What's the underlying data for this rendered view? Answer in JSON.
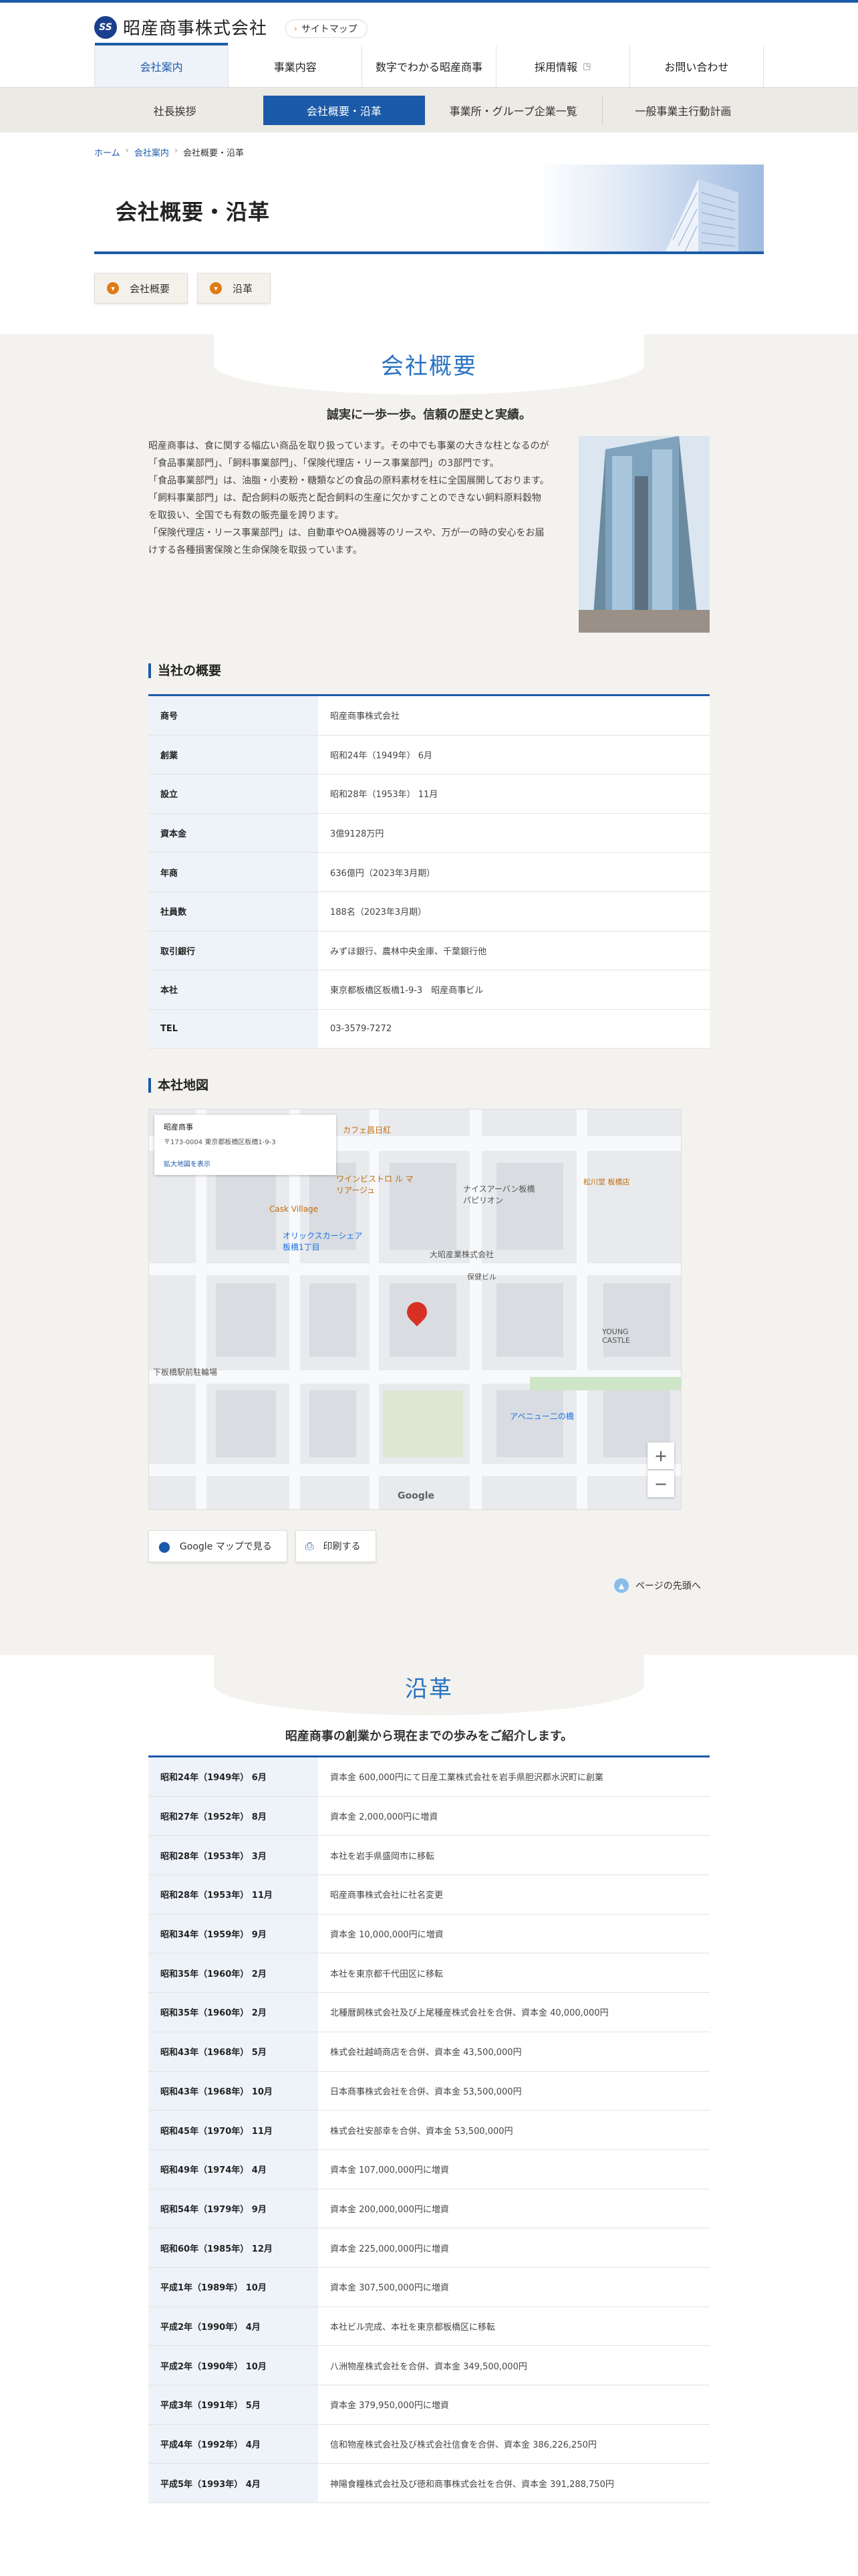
{
  "header": {
    "logo_mark": "SS",
    "company_name": "昭産商事株式会社",
    "sitemap_label": "サイトマップ"
  },
  "global_nav": [
    {
      "label": "会社案内",
      "active": true
    },
    {
      "label": "事業内容",
      "active": false
    },
    {
      "label": "数字でわかる昭産商事",
      "active": false
    },
    {
      "label": "採用情報",
      "active": false
    },
    {
      "label": "お問い合わせ",
      "active": false
    }
  ],
  "sub_nav": [
    {
      "label": "社長挨拶",
      "active": false
    },
    {
      "label": "会社概要・沿革",
      "active": true
    },
    {
      "label": "事業所・グループ企業一覧",
      "active": false
    },
    {
      "label": "一般事業主行動計画",
      "active": false
    }
  ],
  "breadcrumb": {
    "home": "ホーム",
    "parent": "会社案内",
    "current": "会社概要・沿革"
  },
  "page_title": "会社概要・沿革",
  "anchors": [
    {
      "label": "会社概要"
    },
    {
      "label": "沿革"
    }
  ],
  "overview": {
    "title": "会社概要",
    "lead": "誠実に一歩一歩。信頼の歴史と実績。",
    "intro": [
      "昭産商事は、食に関する幅広い商品を取り扱っています。その中でも事業の大きな柱となるのが「食品事業部門」、「飼料事業部門」、「保険代理店・リース事業部門」の3部門です。",
      "「食品事業部門」は、油脂・小麦粉・糖類などの食品の原料素材を柱に全国展開しております。",
      "「飼料事業部門」は、配合飼料の販売と配合飼料の生産に欠かすことのできない飼料原料穀物を取扱い、全国でも有数の販売量を誇ります。",
      "「保険代理店・リース事業部門」は、自動車やOA機器等のリースや、万が一の時の安心をお届けする各種損害保険と生命保険を取扱っています。"
    ],
    "outline_heading": "当社の概要",
    "outline": [
      {
        "th": "商号",
        "td": "昭産商事株式会社"
      },
      {
        "th": "創業",
        "td": "昭和24年（1949年） 6月"
      },
      {
        "th": "設立",
        "td": "昭和28年（1953年） 11月"
      },
      {
        "th": "資本金",
        "td": "3億9128万円"
      },
      {
        "th": "年商",
        "td": "636億円（2023年3月期）"
      },
      {
        "th": "社員数",
        "td": "188名（2023年3月期）"
      },
      {
        "th": "取引銀行",
        "td": "みずほ銀行、農林中央金庫、千葉銀行他"
      },
      {
        "th": "本社",
        "td": "東京都板橋区板橋1-9-3　昭産商事ビル"
      },
      {
        "th": "TEL",
        "td": "03-3579-7272"
      }
    ],
    "map_heading": "本社地図",
    "map_info": {
      "name": "昭産商事",
      "addr": "〒173-0004 東京都板橋区板橋1-9-3",
      "link": "拡大地図を表示"
    },
    "map_labels": [
      "カフェ昌日紅",
      "ワインビストロ ル マリアージュ",
      "Cask Village",
      "オリックスカーシェア 板橋1丁目",
      "ナイスアーバン板橋 パピリオン",
      "松川堂 板橋店",
      "大昭産業株式会社",
      "保健ビル",
      "YOUNG CASTLE",
      "アベニュー二の橋",
      "下板橋駅前駐輪場",
      "Google"
    ],
    "map_button": "Google マップで見る",
    "print_button": "印刷する",
    "page_top": "ページの先頭へ"
  },
  "history": {
    "title": "沿革",
    "lead": "昭産商事の創業から現在までの歩みをご紹介します。",
    "rows": [
      {
        "th": "昭和24年（1949年） 6月",
        "td": "資本金 600,000円にて日産工業株式会社を岩手県胆沢郡水沢町に創業"
      },
      {
        "th": "昭和27年（1952年） 8月",
        "td": "資本金 2,000,000円に増資"
      },
      {
        "th": "昭和28年（1953年） 3月",
        "td": "本社を岩手県盛岡市に移転"
      },
      {
        "th": "昭和28年（1953年） 11月",
        "td": "昭産商事株式会社に社名変更"
      },
      {
        "th": "昭和34年（1959年） 9月",
        "td": "資本金 10,000,000円に増資"
      },
      {
        "th": "昭和35年（1960年） 2月",
        "td": "本社を東京都千代田区に移転"
      },
      {
        "th": "昭和35年（1960年） 2月",
        "td": "北種暦飼株式会社及び上尾種産株式会社を合併、資本金 40,000,000円"
      },
      {
        "th": "昭和43年（1968年） 5月",
        "td": "株式会社越崎商店を合併、資本金 43,500,000円"
      },
      {
        "th": "昭和43年（1968年） 10月",
        "td": "日本商事株式会社を合併、資本金 53,500,000円"
      },
      {
        "th": "昭和45年（1970年） 11月",
        "td": "株式会社安部幸を合併、資本金 53,500,000円"
      },
      {
        "th": "昭和49年（1974年） 4月",
        "td": "資本金 107,000,000円に増資"
      },
      {
        "th": "昭和54年（1979年） 9月",
        "td": "資本金 200,000,000円に増資"
      },
      {
        "th": "昭和60年（1985年） 12月",
        "td": "資本金 225,000,000円に増資"
      },
      {
        "th": "平成1年（1989年） 10月",
        "td": "資本金 307,500,000円に増資"
      },
      {
        "th": "平成2年（1990年） 4月",
        "td": "本社ビル完成、本社を東京都板橋区に移転"
      },
      {
        "th": "平成2年（1990年） 10月",
        "td": "八洲物産株式会社を合併、資本金 349,500,000円"
      },
      {
        "th": "平成3年（1991年） 5月",
        "td": "資本金 379,950,000円に増資"
      },
      {
        "th": "平成4年（1992年） 4月",
        "td": "信和物産株式会社及び株式会社信食を合併、資本金 386,226,250円"
      },
      {
        "th": "平成5年（1993年） 4月",
        "td": "神陽食糧株式会社及び徳和商事株式会社を合併、資本金 391,288,750円"
      }
    ]
  },
  "colors": {
    "brand": "#1b5aa8",
    "accent": "#e07a17",
    "title": "#2a73c1"
  }
}
